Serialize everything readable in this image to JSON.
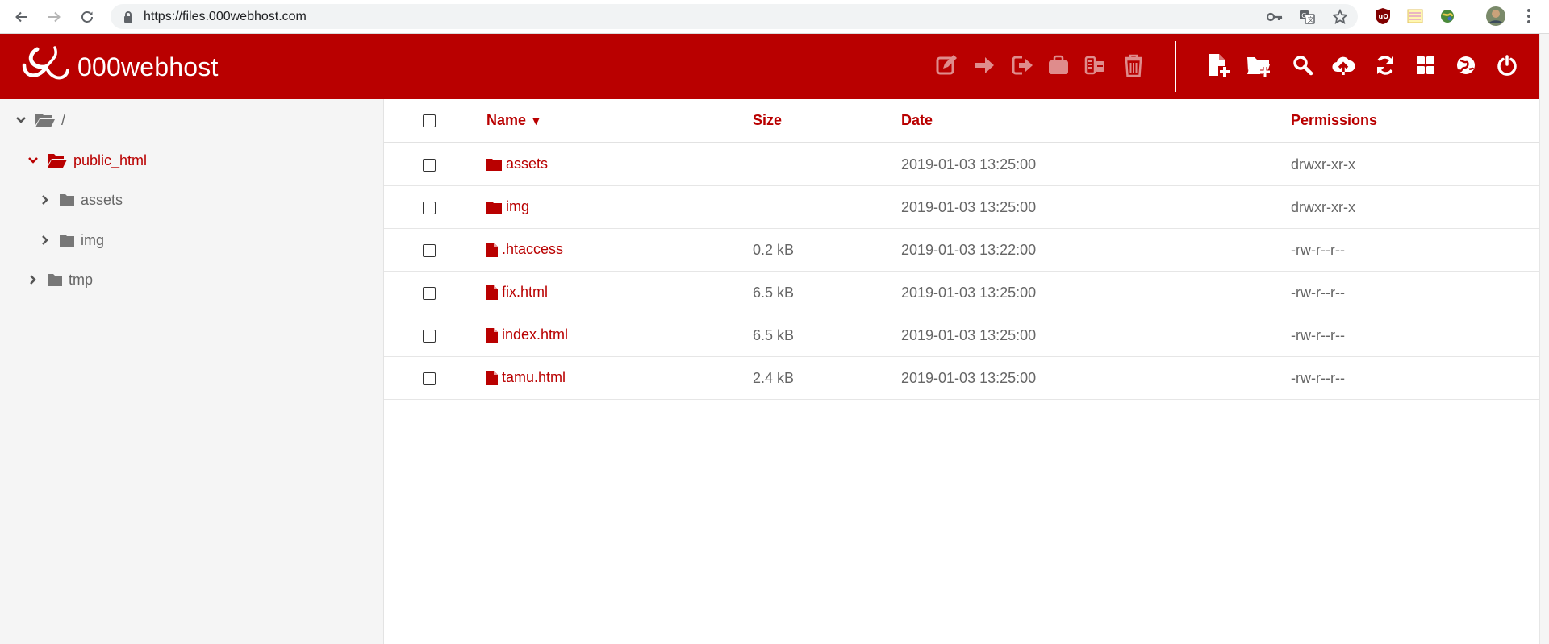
{
  "browser": {
    "url": "https://files.000webhost.com",
    "icons": [
      "back-arrow-icon",
      "forward-arrow-icon",
      "reload-icon",
      "lock-icon",
      "key-icon",
      "translate-icon",
      "star-icon",
      "ublock-extension-icon",
      "notes-extension-icon",
      "globe-extension-icon",
      "profile-avatar",
      "menu-dots-icon"
    ]
  },
  "header": {
    "brand": "000webhost",
    "accent_color": "#b90000",
    "toolbar_left": [
      "edit-icon",
      "move-icon",
      "rename-icon",
      "archive-icon",
      "extract-icon",
      "delete-icon"
    ],
    "toolbar_right": [
      "new-file-icon",
      "new-folder-icon",
      "search-icon",
      "upload-icon",
      "refresh-icon",
      "view-grid-icon",
      "globe-icon",
      "power-icon"
    ]
  },
  "tree": {
    "root": "/",
    "public_html": "public_html",
    "assets": "assets",
    "img": "img",
    "tmp": "tmp"
  },
  "table": {
    "headers": {
      "name": "Name",
      "sort_indicator": "▼",
      "size": "Size",
      "date": "Date",
      "permissions": "Permissions"
    },
    "rows": [
      {
        "type": "folder",
        "name": "assets",
        "size": "",
        "date": "2019-01-03 13:25:00",
        "permissions": "drwxr-xr-x"
      },
      {
        "type": "folder",
        "name": "img",
        "size": "",
        "date": "2019-01-03 13:25:00",
        "permissions": "drwxr-xr-x"
      },
      {
        "type": "file",
        "name": ".htaccess",
        "size": "0.2 kB",
        "date": "2019-01-03 13:22:00",
        "permissions": "-rw-r--r--"
      },
      {
        "type": "file",
        "name": "fix.html",
        "size": "6.5 kB",
        "date": "2019-01-03 13:25:00",
        "permissions": "-rw-r--r--"
      },
      {
        "type": "file",
        "name": "index.html",
        "size": "6.5 kB",
        "date": "2019-01-03 13:25:00",
        "permissions": "-rw-r--r--"
      },
      {
        "type": "file",
        "name": "tamu.html",
        "size": "2.4 kB",
        "date": "2019-01-03 13:25:00",
        "permissions": "-rw-r--r--"
      }
    ]
  }
}
